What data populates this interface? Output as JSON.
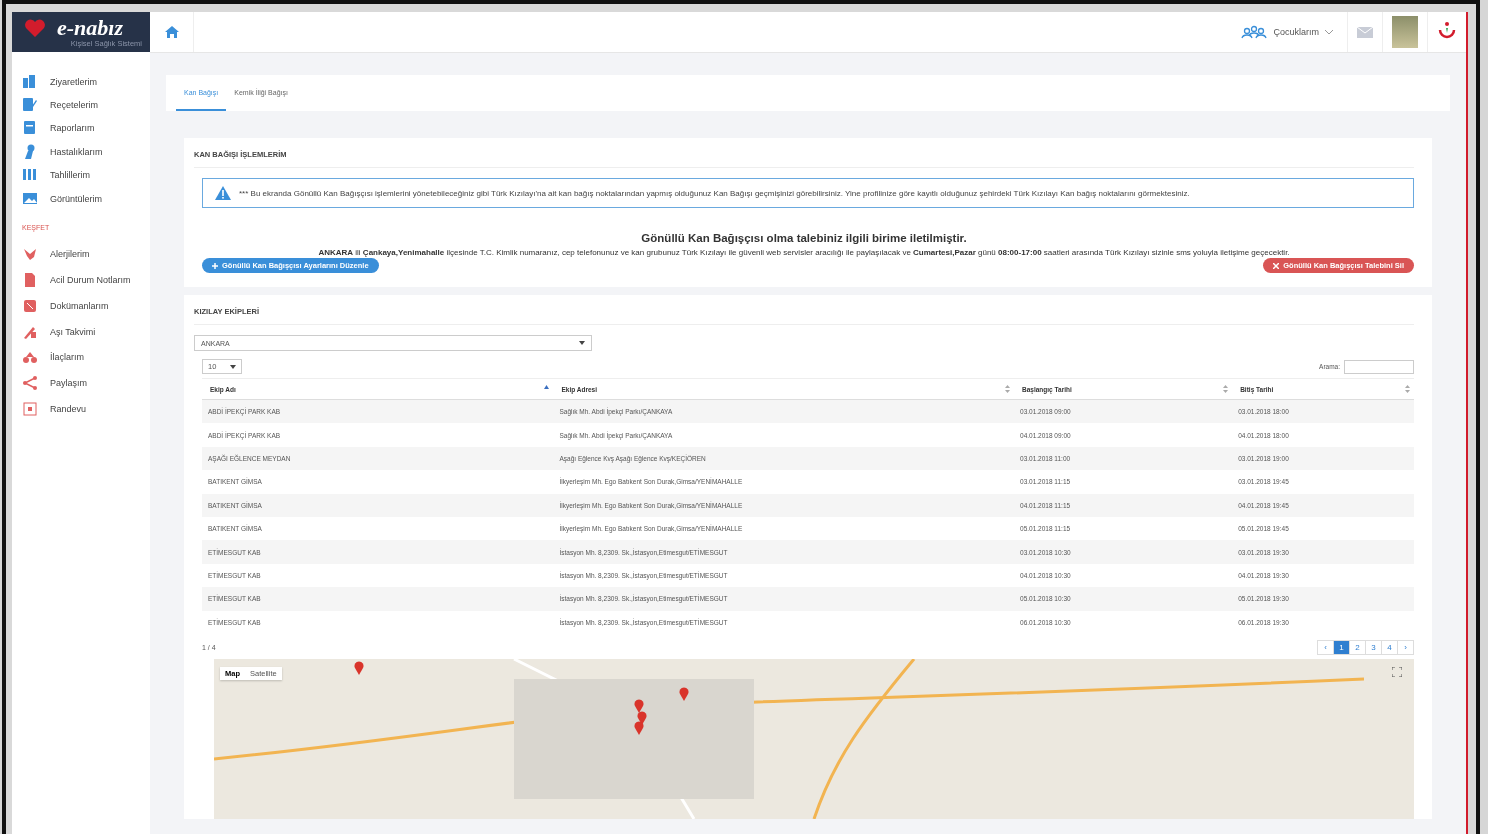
{
  "header": {
    "user_menu": "Çocuklarım"
  },
  "logo": {
    "name": "e-nabız",
    "tagline": "Kişisel Sağlık Sistemi"
  },
  "sidebar": {
    "items": [
      {
        "label": "Ziyaretlerim"
      },
      {
        "label": "Reçetelerim"
      },
      {
        "label": "Raporlarım"
      },
      {
        "label": "Hastalıklarım"
      },
      {
        "label": "Tahlillerim"
      },
      {
        "label": "Görüntülerim"
      }
    ],
    "section_title": "KEŞFET",
    "explore_items": [
      {
        "label": "Alerjilerim"
      },
      {
        "label": "Acil Durum Notlarım"
      },
      {
        "label": "Dokümanlarım"
      },
      {
        "label": "Aşı Takvimi"
      },
      {
        "label": "İlaçlarım"
      },
      {
        "label": "Paylaşım"
      },
      {
        "label": "Randevu"
      }
    ]
  },
  "tabs": [
    {
      "label": "Kan Bağışı",
      "selected": true
    },
    {
      "label": "Kemik İliği Bağışı",
      "selected": false
    }
  ],
  "donation_panel": {
    "title": "KAN BAĞIŞI İŞLEMLERİM",
    "alert": "*** Bu ekranda Gönüllü Kan Bağışçısı işlemlerini yönetebileceğiniz gibi Türk Kızılayı'na ait kan bağış noktalarından yapmış olduğunuz Kan Bağışı geçmişinizi görebilirsiniz. Yine profilinize göre kayıtlı olduğunuz şehirdeki Türk Kızılayı Kan bağış noktalarını görmektesiniz.",
    "status_title": "Gönüllü Kan Bağışçısı olma talebiniz ilgili birime iletilmiştir.",
    "status_text": "**ANKARA** ili **Çankaya,Yenimahalle** ilçesinde T.C. Kimlik numaranız, cep telefonunuz ve kan grubunuz Türk Kızılayı ile güvenli web servisler aracılığı ile paylaşılacak ve **Cumartesi,Pazar** günü **08:00-17:00** saatleri arasında Türk Kızılayı sizinle sms yoluyla iletişime geçecektir.",
    "edit_button": "Gönüllü Kan Bağışçısı Ayarlarını Düzenle",
    "delete_button": "Gönüllü Kan Bağışçısı Talebini Sil"
  },
  "teams_panel": {
    "title": "KIZILAY EKİPLERİ",
    "city": "ANKARA",
    "page_size": "10",
    "search_label": "Arama:",
    "table": {
      "columns": [
        {
          "label": "Ekip Adı",
          "sorted": true
        },
        {
          "label": "Ekip Adresi",
          "sorted": false
        },
        {
          "label": "Başlangıç Tarihi",
          "sorted": false
        },
        {
          "label": "Bitiş Tarihi",
          "sorted": false
        }
      ],
      "rows": [
        [
          "ABDİ İPEKÇİ PARK KAB",
          "Sağlık Mh. Abdi İpekçi Parkı/ÇANKAYA",
          "03.01.2018 09:00",
          "03.01.2018 18:00"
        ],
        [
          "ABDİ İPEKÇİ PARK KAB",
          "Sağlık Mh. Abdi İpekçi Parkı/ÇANKAYA",
          "04.01.2018 09:00",
          "04.01.2018 18:00"
        ],
        [
          "AŞAĞI EĞLENCE MEYDAN",
          "Aşağı Eğlence Kvş Aşağı Eğlence Kvş/KEÇİÖREN",
          "03.01.2018 11:00",
          "03.01.2018 19:00"
        ],
        [
          "BATIKENT GİMSA",
          "İlkyerleşim Mh. Ego Batıkent Son Durak,Gimsa/YENİMAHALLE",
          "03.01.2018 11:15",
          "03.01.2018 19:45"
        ],
        [
          "BATIKENT GİMSA",
          "İlkyerleşim Mh. Ego Batıkent Son Durak,Gimsa/YENİMAHALLE",
          "04.01.2018 11:15",
          "04.01.2018 19:45"
        ],
        [
          "BATIKENT GİMSA",
          "İlkyerleşim Mh. Ego Batıkent Son Durak,Gimsa/YENİMAHALLE",
          "05.01.2018 11:15",
          "05.01.2018 19:45"
        ],
        [
          "ETİMESGUT KAB",
          "İstasyon Mh. 8,2309. Sk.,İstasyon,Etimesgut/ETİMESGUT",
          "03.01.2018 10:30",
          "03.01.2018 19:30"
        ],
        [
          "ETİMESGUT KAB",
          "İstasyon Mh. 8,2309. Sk.,İstasyon,Etimesgut/ETİMESGUT",
          "04.01.2018 10:30",
          "04.01.2018 19:30"
        ],
        [
          "ETİMESGUT KAB",
          "İstasyon Mh. 8,2309. Sk.,İstasyon,Etimesgut/ETİMESGUT",
          "05.01.2018 10:30",
          "05.01.2018 19:30"
        ],
        [
          "ETİMESGUT KAB",
          "İstasyon Mh. 8,2309. Sk.,İstasyon,Etimesgut/ETİMESGUT",
          "06.01.2018 10:30",
          "06.01.2018 19:30"
        ]
      ]
    },
    "page_info": "1 / 4",
    "pager": {
      "prev": "‹",
      "next": "›",
      "pages": [
        {
          "label": "1",
          "selected": true
        },
        {
          "label": "2",
          "selected": false
        },
        {
          "label": "3",
          "selected": false
        },
        {
          "label": "4",
          "selected": false
        }
      ]
    },
    "map": {
      "types": [
        {
          "label": "Map",
          "selected": true
        },
        {
          "label": "Satellite",
          "selected": false
        }
      ]
    }
  }
}
